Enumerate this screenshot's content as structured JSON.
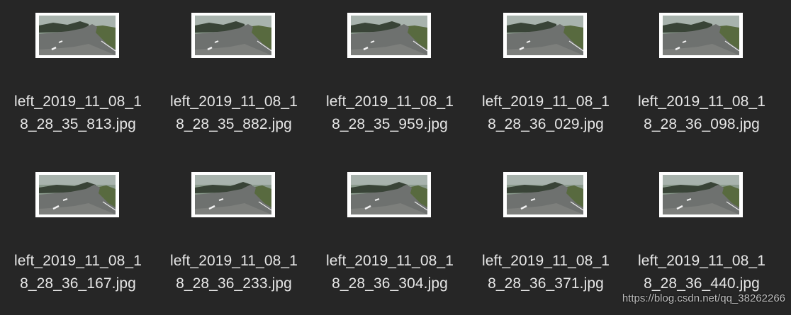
{
  "files": [
    {
      "name_line1": "left_2019_11_08_1",
      "name_line2": "8_28_35_813.jpg",
      "thumbnail": "road-curve-image-icon"
    },
    {
      "name_line1": "left_2019_11_08_1",
      "name_line2": "8_28_35_882.jpg",
      "thumbnail": "road-curve-image-icon"
    },
    {
      "name_line1": "left_2019_11_08_1",
      "name_line2": "8_28_35_959.jpg",
      "thumbnail": "road-curve-image-icon"
    },
    {
      "name_line1": "left_2019_11_08_1",
      "name_line2": "8_28_36_029.jpg",
      "thumbnail": "road-curve-image-icon"
    },
    {
      "name_line1": "left_2019_11_08_1",
      "name_line2": "8_28_36_098.jpg",
      "thumbnail": "road-curve-image-icon"
    },
    {
      "name_line1": "left_2019_11_08_1",
      "name_line2": "8_28_36_167.jpg",
      "thumbnail": "road-curve-image-icon"
    },
    {
      "name_line1": "left_2019_11_08_1",
      "name_line2": "8_28_36_233.jpg",
      "thumbnail": "road-curve-image-icon"
    },
    {
      "name_line1": "left_2019_11_08_1",
      "name_line2": "8_28_36_304.jpg",
      "thumbnail": "road-curve-image-icon"
    },
    {
      "name_line1": "left_2019_11_08_1",
      "name_line2": "8_28_36_371.jpg",
      "thumbnail": "road-curve-image-icon"
    },
    {
      "name_line1": "left_2019_11_08_1",
      "name_line2": "8_28_36_440.jpg",
      "thumbnail": "road-curve-image-icon"
    }
  ],
  "watermark": "https://blog.csdn.net/qq_38262266",
  "colors": {
    "background": "#262626",
    "label_text": "#e6e6e6",
    "thumbnail_border": "#ffffff"
  }
}
